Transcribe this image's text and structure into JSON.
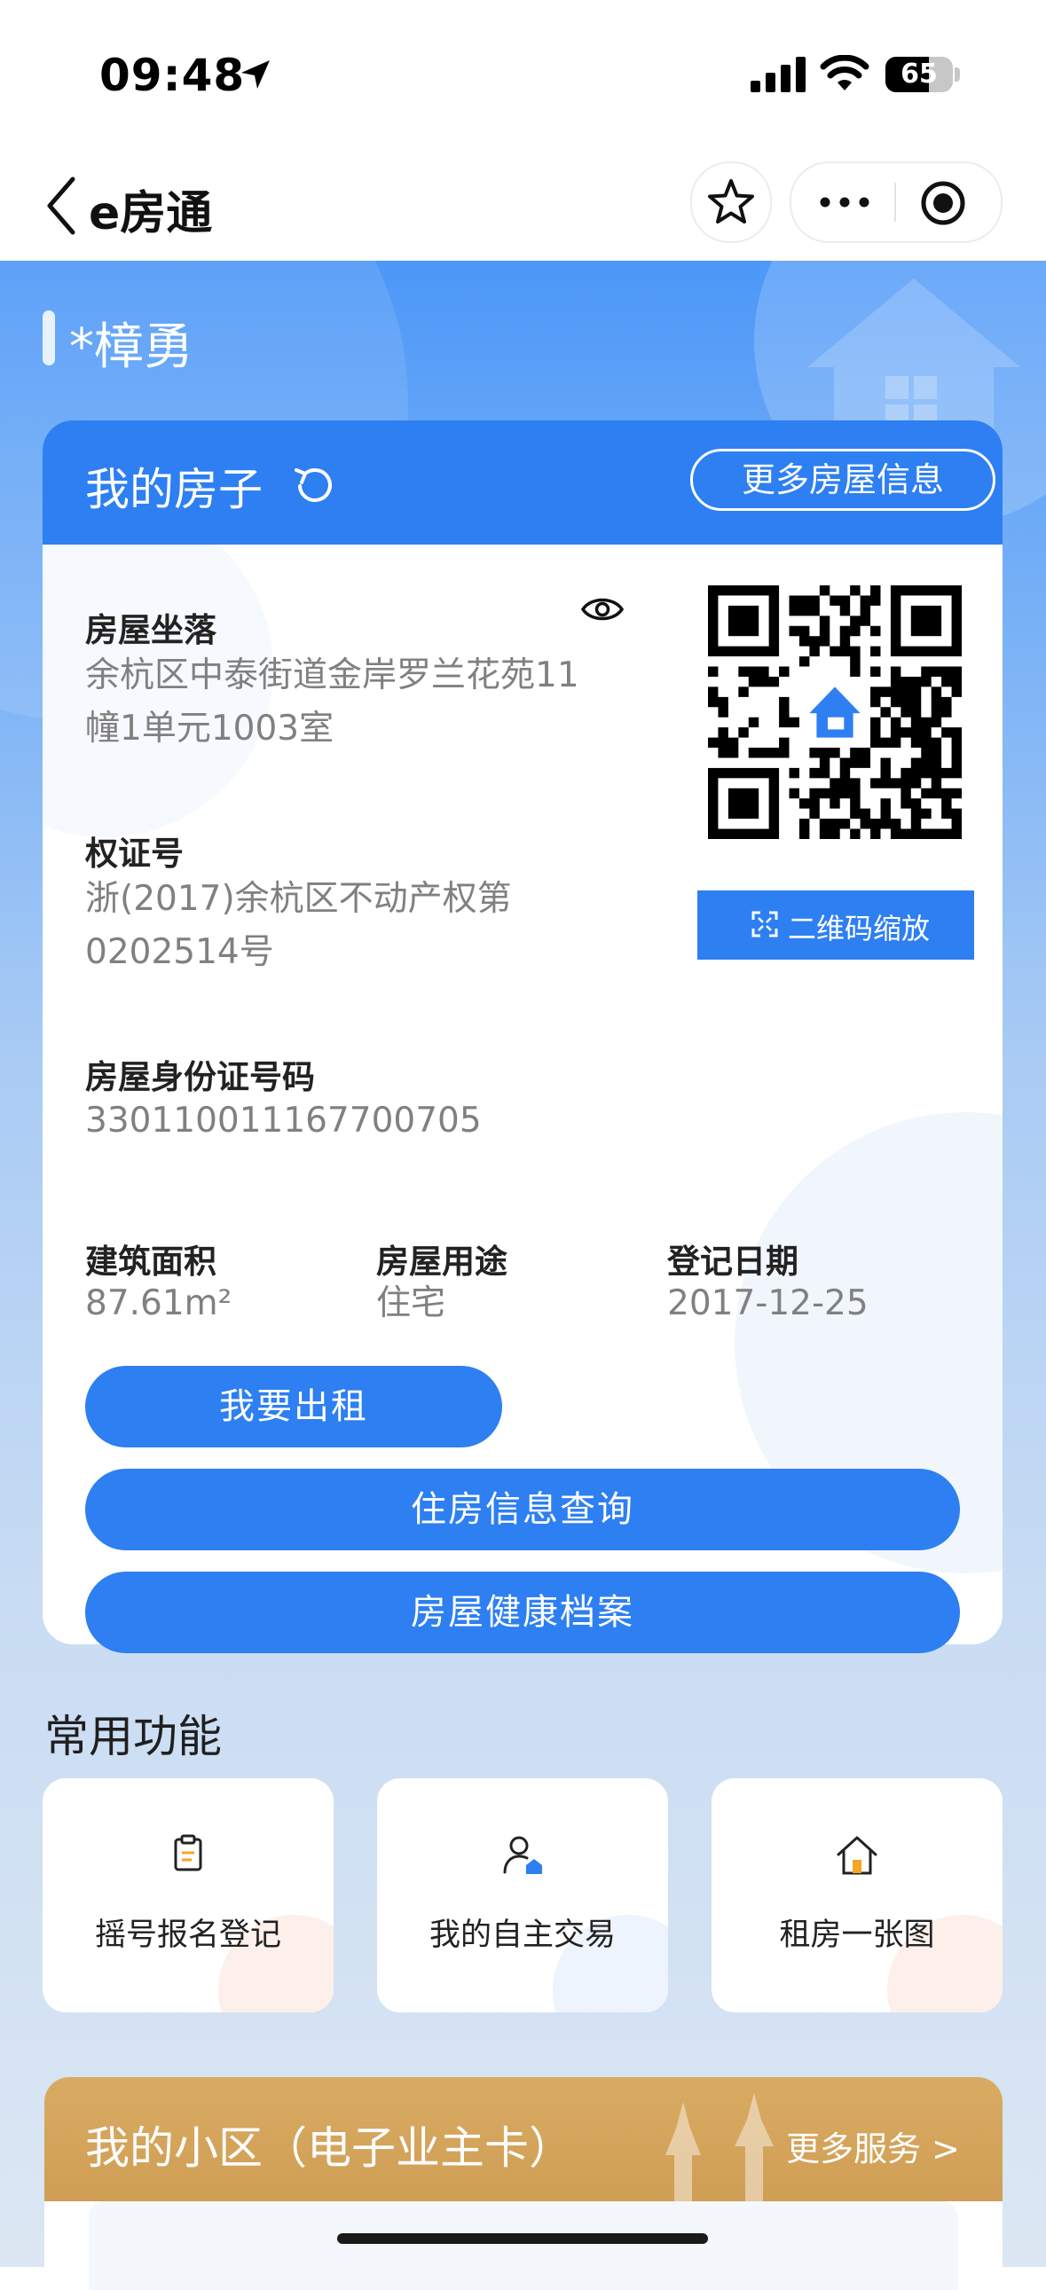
{
  "status_bar": {
    "time": "09:48",
    "battery": "65",
    "battery_level": 0.65
  },
  "nav": {
    "back_icon": "chevron-left-icon",
    "title": "e房通",
    "star_icon": "star-icon",
    "more_icon": "more-dots-icon",
    "close_icon": "target-circle-icon"
  },
  "owner": {
    "name": "*樟勇"
  },
  "house_card": {
    "title": "我的房子",
    "more_info_label": "更多房屋信息",
    "location": {
      "label": "房屋坐落",
      "value_line1": "余杭区中泰街道金岸罗兰花苑11",
      "value_line2": "幢1单元1003室"
    },
    "certificate": {
      "label": "权证号",
      "value_line1": "浙(2017)余杭区不动产权第",
      "value_line2": "0202514号"
    },
    "house_id": {
      "label": "房屋身份证号码",
      "value": "330110011167700705"
    },
    "area": {
      "label": "建筑面积",
      "value": "87.61m²"
    },
    "usage": {
      "label": "房屋用途",
      "value": "住宅"
    },
    "register_date": {
      "label": "登记日期",
      "value": "2017-12-25"
    },
    "qr_zoom_label": "二维码缩放",
    "buttons": {
      "rent": "我要出租",
      "query": "住房信息查询",
      "health": "房屋健康档案"
    }
  },
  "common": {
    "title": "常用功能",
    "items": [
      {
        "label": "摇号报名登记",
        "icon": "clipboard-icon"
      },
      {
        "label": "我的自主交易",
        "icon": "user-house-icon"
      },
      {
        "label": "租房一张图",
        "icon": "house-icon"
      }
    ]
  },
  "estate": {
    "title": "我的小区（电子业主卡）",
    "more": "更多服务 >"
  },
  "colors": {
    "primary": "#2d7ff2",
    "estate_gold": "#d2a257"
  }
}
